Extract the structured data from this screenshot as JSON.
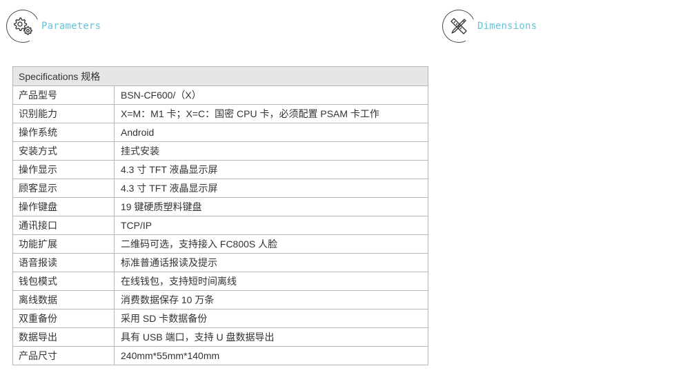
{
  "parameters": {
    "title": "Parameters",
    "icon": "gears-icon"
  },
  "dimensions": {
    "title": "Dimensions",
    "icon": "pencil-ruler-icon"
  },
  "colors": {
    "accent": "#62c3db",
    "header_bg": "#e6e6e6",
    "border": "#b7b7b7",
    "text": "#333333"
  },
  "spec_table": {
    "header": "Specifications 规格",
    "rows": [
      {
        "label": "产品型号",
        "value": "BSN-CF600/（X）"
      },
      {
        "label": "识别能力",
        "value": "X=M：M1 卡；X=C：国密 CPU 卡，必须配置 PSAM 卡工作"
      },
      {
        "label": "操作系统",
        "value": "Android"
      },
      {
        "label": "安装方式",
        "value": "挂式安装"
      },
      {
        "label": "操作显示",
        "value": "4.3 寸 TFT 液晶显示屏"
      },
      {
        "label": "顾客显示",
        "value": "4.3 寸 TFT 液晶显示屏"
      },
      {
        "label": "操作键盘",
        "value": "19 键硬质塑料键盘"
      },
      {
        "label": "通讯接口",
        "value": "TCP/IP"
      },
      {
        "label": "功能扩展",
        "value": "二维码可选，支持接入 FC800S 人脸"
      },
      {
        "label": "语音报读",
        "value": "标准普通话报读及提示"
      },
      {
        "label": "钱包模式",
        "value": "在线钱包，支持短时间离线"
      },
      {
        "label": "离线数据",
        "value": "消费数据保存 10 万条"
      },
      {
        "label": "双重备份",
        "value": "采用 SD 卡数据备份"
      },
      {
        "label": "数据导出",
        "value": "具有 USB 端口，支持 U 盘数据导出"
      },
      {
        "label": "产品尺寸",
        "value": "240mm*55mm*140mm"
      }
    ]
  }
}
